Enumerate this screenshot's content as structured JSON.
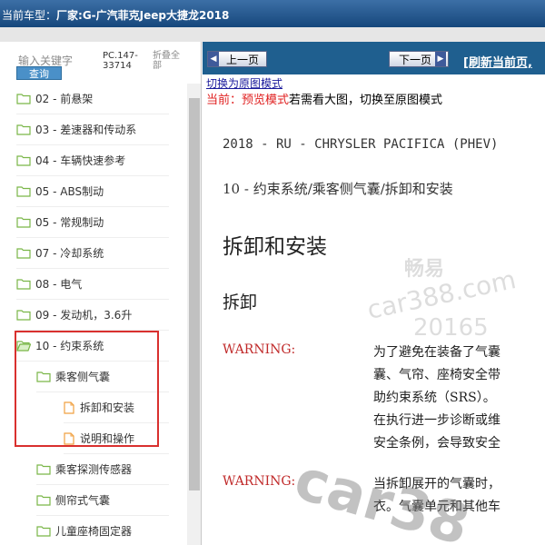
{
  "header": {
    "label": "当前车型：",
    "model": "厂家:G-广汽菲克Jeep大捷龙2018"
  },
  "sidebar": {
    "search_placeholder": "输入关键字",
    "search_button": "查询",
    "pc_code": "PC.147-33714",
    "fold_all": "折叠全部",
    "items": [
      {
        "label": "02 - 前悬架",
        "level": 0,
        "icon": "folder-icon"
      },
      {
        "label": "03 - 差速器和传动系",
        "level": 0,
        "icon": "folder-icon"
      },
      {
        "label": "04 - 车辆快速参考",
        "level": 0,
        "icon": "folder-icon"
      },
      {
        "label": "05 - ABS制动",
        "level": 0,
        "icon": "folder-icon"
      },
      {
        "label": "05 - 常规制动",
        "level": 0,
        "icon": "folder-icon"
      },
      {
        "label": "07 - 冷却系统",
        "level": 0,
        "icon": "folder-icon"
      },
      {
        "label": "08 - 电气",
        "level": 0,
        "icon": "folder-icon"
      },
      {
        "label": "09 - 发动机，3.6升",
        "level": 0,
        "icon": "folder-icon"
      },
      {
        "label": "10 - 约束系统",
        "level": 0,
        "icon": "folder-open-icon"
      },
      {
        "label": "乘客侧气囊",
        "level": 1,
        "icon": "folder-icon"
      },
      {
        "label": "拆卸和安装",
        "level": 2,
        "icon": "document-icon"
      },
      {
        "label": "说明和操作",
        "level": 2,
        "icon": "document-icon"
      },
      {
        "label": "乘客探测传感器",
        "level": 1,
        "icon": "folder-icon"
      },
      {
        "label": "侧帘式气囊",
        "level": 1,
        "icon": "folder-icon"
      },
      {
        "label": "儿童座椅固定器",
        "level": 1,
        "icon": "folder-icon"
      }
    ]
  },
  "toolbar": {
    "prev_label": "上一页",
    "next_label": "下一页",
    "refresh_label": "[刷新当前页,"
  },
  "content": {
    "mode_link": "切换为原图模式",
    "mode_prefix": "当前：",
    "mode_name": "预览模式",
    "mode_suffix": "若需看大图，切换至原图模式",
    "vehicle": "2018 - RU - CHRYSLER PACIFICA (PHEV)",
    "path": "10 - 约束系统/乘客侧气囊/拆卸和安装",
    "heading": "拆卸和安装",
    "subheading": "拆卸",
    "warning_label": "WARNING:",
    "warning1_lines": [
      "为了避免在装备了气囊",
      "囊、气帘、座椅安全带",
      "助约束系统（SRS）。",
      "在执行进一步诊断或维",
      "安全条例，会导致安全"
    ],
    "warning2_lines": [
      "当拆卸展开的气囊时，",
      "衣。气囊单元和其他车"
    ]
  },
  "watermark": {
    "brand": "畅易",
    "site": "car388.com",
    "code": "20165",
    "big": "car38"
  },
  "colors": {
    "header_bg": "#16477c",
    "nav_bg": "#1f5f8f",
    "highlight": "#d9302e",
    "warning": "#c02a2a",
    "folder": "#7ab648",
    "document": "#f0a040"
  }
}
